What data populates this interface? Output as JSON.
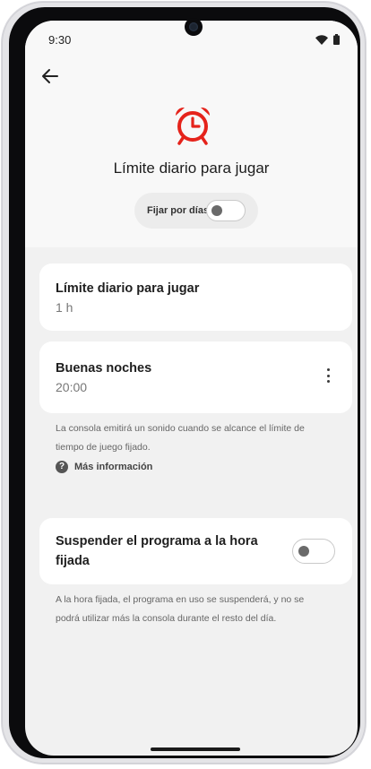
{
  "status_bar": {
    "time": "9:30",
    "wifi_icon": "wifi-icon",
    "battery_icon": "battery-icon"
  },
  "header": {
    "back_icon": "arrow-left-icon",
    "hero_icon": "alarm-clock-icon",
    "title": "Límite diario para jugar",
    "per_day_toggle": {
      "label": "Fijar por días",
      "on": false
    }
  },
  "cards": {
    "daily_limit": {
      "title": "Límite diario para jugar",
      "value": "1 h"
    },
    "good_night": {
      "title": "Buenas noches",
      "value": "20:00",
      "menu_icon": "more-vert-icon"
    },
    "suspend": {
      "title_line1": "Suspender el programa a la hora",
      "title_line2": "fijada",
      "on": false
    }
  },
  "notes": {
    "alarm_line1": "La consola emitirá un sonido cuando se alcance el límite de",
    "alarm_line2": "tiempo de juego fijado.",
    "more_info": "Más información",
    "more_info_icon": "help-circle-icon",
    "suspend_line1": "A la hora fijada, el programa en uso se suspenderá, y no se",
    "suspend_line2": "podrá utilizar más la consola durante el resto del día."
  },
  "colors": {
    "accent": "#e5231b",
    "screen_bg": "#f1f1f1",
    "card_bg": "#ffffff"
  }
}
